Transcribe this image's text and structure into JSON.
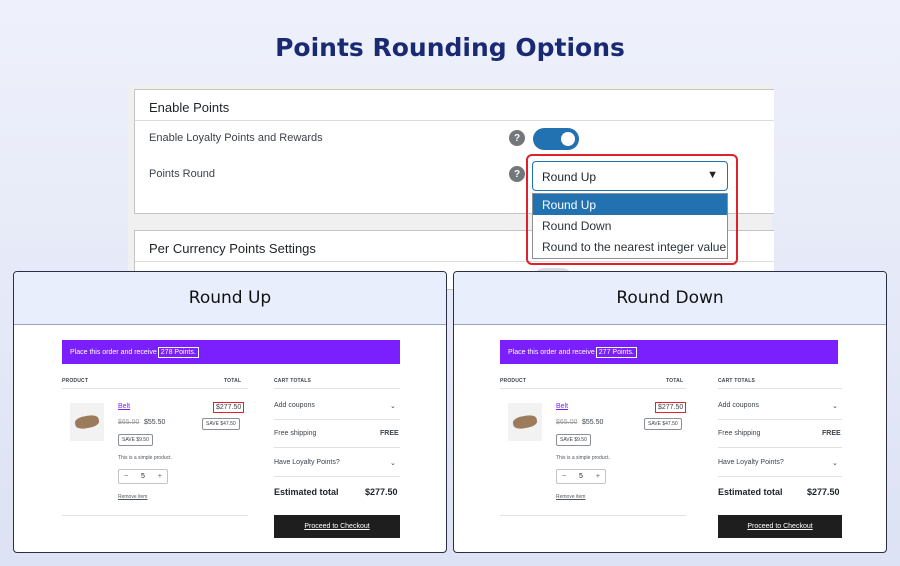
{
  "title": "Points Rounding Options",
  "settings": {
    "section1_title": "Enable Points",
    "enable_label": "Enable Loyalty Points and Rewards",
    "round_label": "Points Round",
    "help_glyph": "?",
    "round_selected": "Round Up",
    "round_options": [
      "Round Up",
      "Round Down",
      "Round to the nearest integer value"
    ],
    "section2_title": "Per Currency Points Settings",
    "toggle_on": true,
    "accent_color": "#2271b1",
    "highlight_color": "#e0202a"
  },
  "panels": [
    {
      "title": "Round Up",
      "notice_prefix": "Place this order and receive",
      "notice_points": "278 Points.",
      "product_header": "PRODUCT",
      "total_header": "TOTAL",
      "cart_totals_header": "CART TOTALS",
      "product_name": "Belt",
      "old_price": "$65.00",
      "new_price": "$55.50",
      "save_badge": "SAVE $9.50",
      "description": "This is a simple product.",
      "qty_minus": "−",
      "qty_value": "5",
      "qty_plus": "+",
      "remove_label": "Remove item",
      "line_total": "$277.50",
      "line_save": "SAVE $47.50",
      "coupons_label": "Add coupons",
      "shipping_label": "Free shipping",
      "shipping_value": "FREE",
      "loyalty_label": "Have Loyalty Points?",
      "estimated_label": "Estimated total",
      "estimated_value": "$277.50",
      "checkout_label": "Proceed to Checkout"
    },
    {
      "title": "Round Down",
      "notice_prefix": "Place this order and receive",
      "notice_points": "277 Points.",
      "product_header": "PRODUCT",
      "total_header": "TOTAL",
      "cart_totals_header": "CART TOTALS",
      "product_name": "Belt",
      "old_price": "$65.00",
      "new_price": "$55.50",
      "save_badge": "SAVE $9.50",
      "description": "This is a simple product.",
      "qty_minus": "−",
      "qty_value": "5",
      "qty_plus": "+",
      "remove_label": "Remove item",
      "line_total": "$277.50",
      "line_save": "SAVE $47.50",
      "coupons_label": "Add coupons",
      "shipping_label": "Free shipping",
      "shipping_value": "FREE",
      "loyalty_label": "Have Loyalty Points?",
      "estimated_label": "Estimated total",
      "estimated_value": "$277.50",
      "checkout_label": "Proceed to Checkout"
    }
  ]
}
